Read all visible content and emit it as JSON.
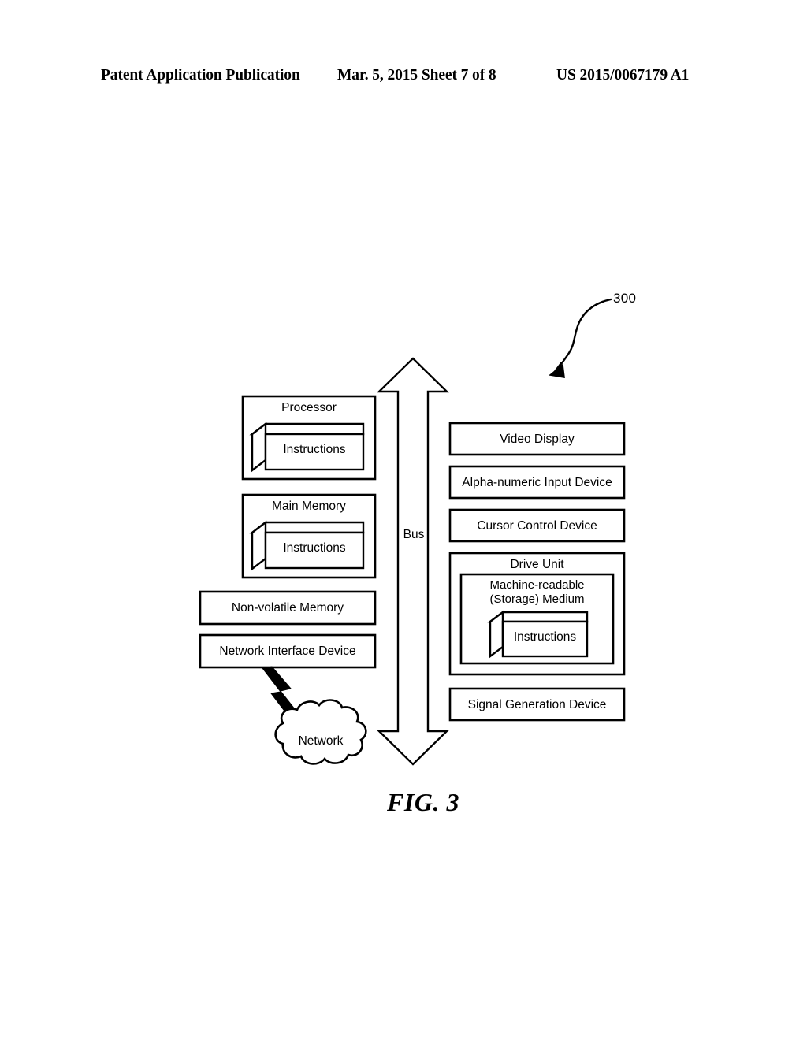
{
  "header": {
    "left": "Patent Application Publication",
    "middle": "Mar. 5, 2015  Sheet 7 of 8",
    "right": "US 2015/0067179 A1"
  },
  "figure": {
    "caption": "FIG. 3",
    "reference_numeral": "300",
    "bus_label": "Bus",
    "left_column": [
      {
        "id": "processor",
        "title": "Processor",
        "inner_box_label": "Instructions"
      },
      {
        "id": "main-memory",
        "title": "Main Memory",
        "inner_box_label": "Instructions"
      },
      {
        "id": "non-volatile-memory",
        "title": "Non-volatile Memory",
        "inner_box_label": null
      },
      {
        "id": "network-interface-device",
        "title": "Network Interface Device",
        "inner_box_label": null
      }
    ],
    "network_cloud": {
      "label": "Network"
    },
    "right_column": [
      {
        "id": "video-display",
        "title": "Video Display"
      },
      {
        "id": "alpha-numeric-input-device",
        "title": "Alpha-numeric Input Device"
      },
      {
        "id": "cursor-control-device",
        "title": "Cursor Control Device"
      },
      {
        "id": "drive-unit",
        "title": "Drive Unit",
        "nested": {
          "title": "Machine-readable\n(Storage) Medium",
          "inner_box_label": "Instructions"
        }
      },
      {
        "id": "signal-generation-device",
        "title": "Signal Generation Device"
      }
    ]
  },
  "style": {
    "ink": "#000000",
    "page": "#ffffff"
  }
}
